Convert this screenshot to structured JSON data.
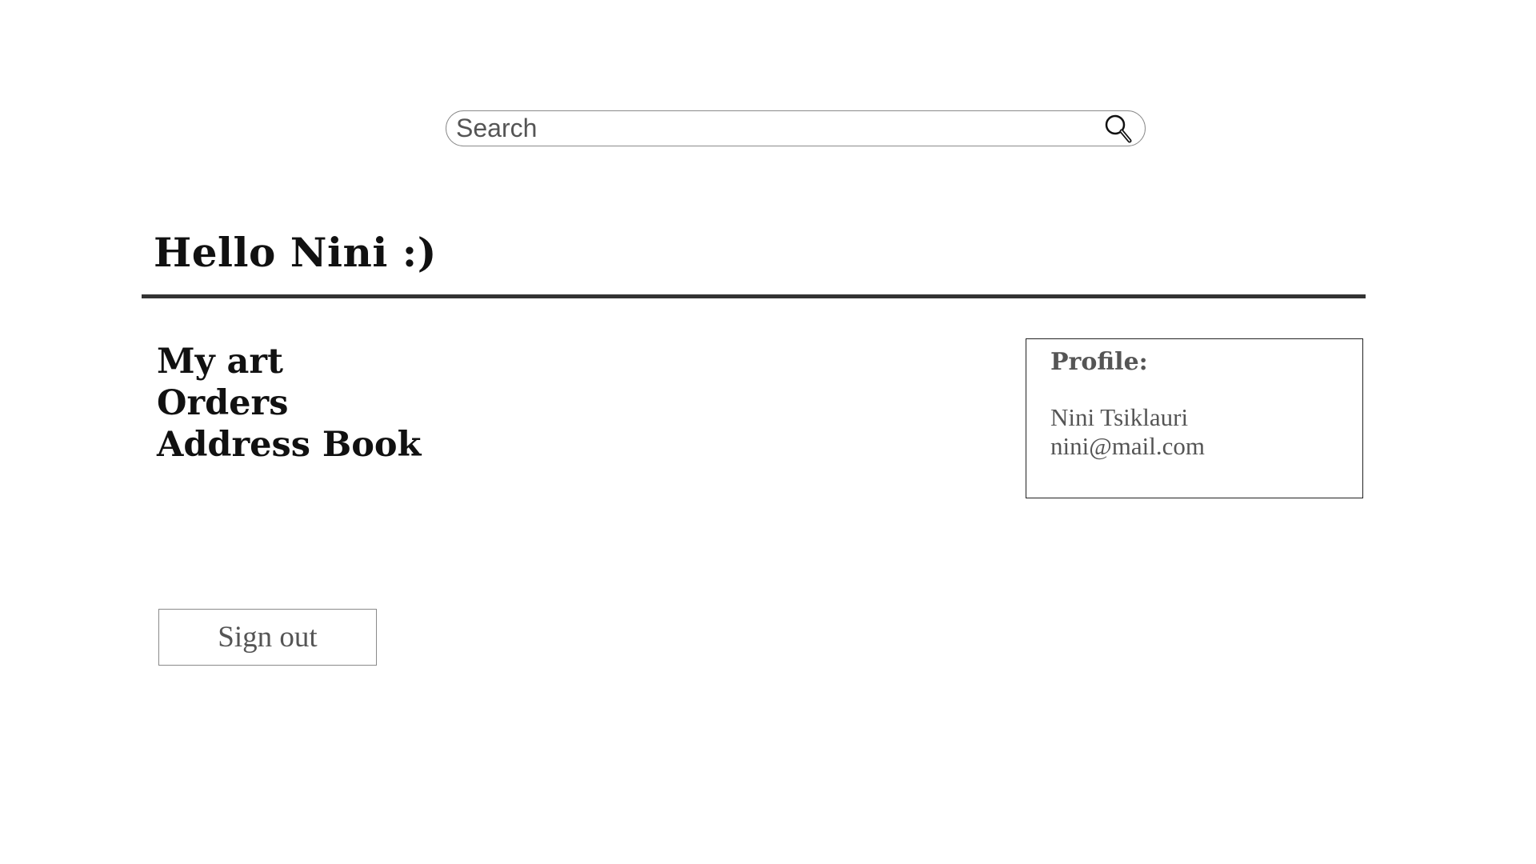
{
  "search": {
    "placeholder": "Search",
    "icon": "magnifier"
  },
  "greeting": "Hello Nini :)",
  "nav": {
    "items": [
      {
        "label": "My art"
      },
      {
        "label": "Orders"
      },
      {
        "label": "Address Book"
      }
    ]
  },
  "profile": {
    "title": "Profile:",
    "name": "Nini Tsiklauri",
    "email": "nini@mail.com"
  },
  "signout": {
    "label": "Sign out"
  },
  "colors": {
    "text_dark": "#111111",
    "text_gray": "#555555",
    "divider": "#333333",
    "border_gray": "#8a8a8a"
  }
}
